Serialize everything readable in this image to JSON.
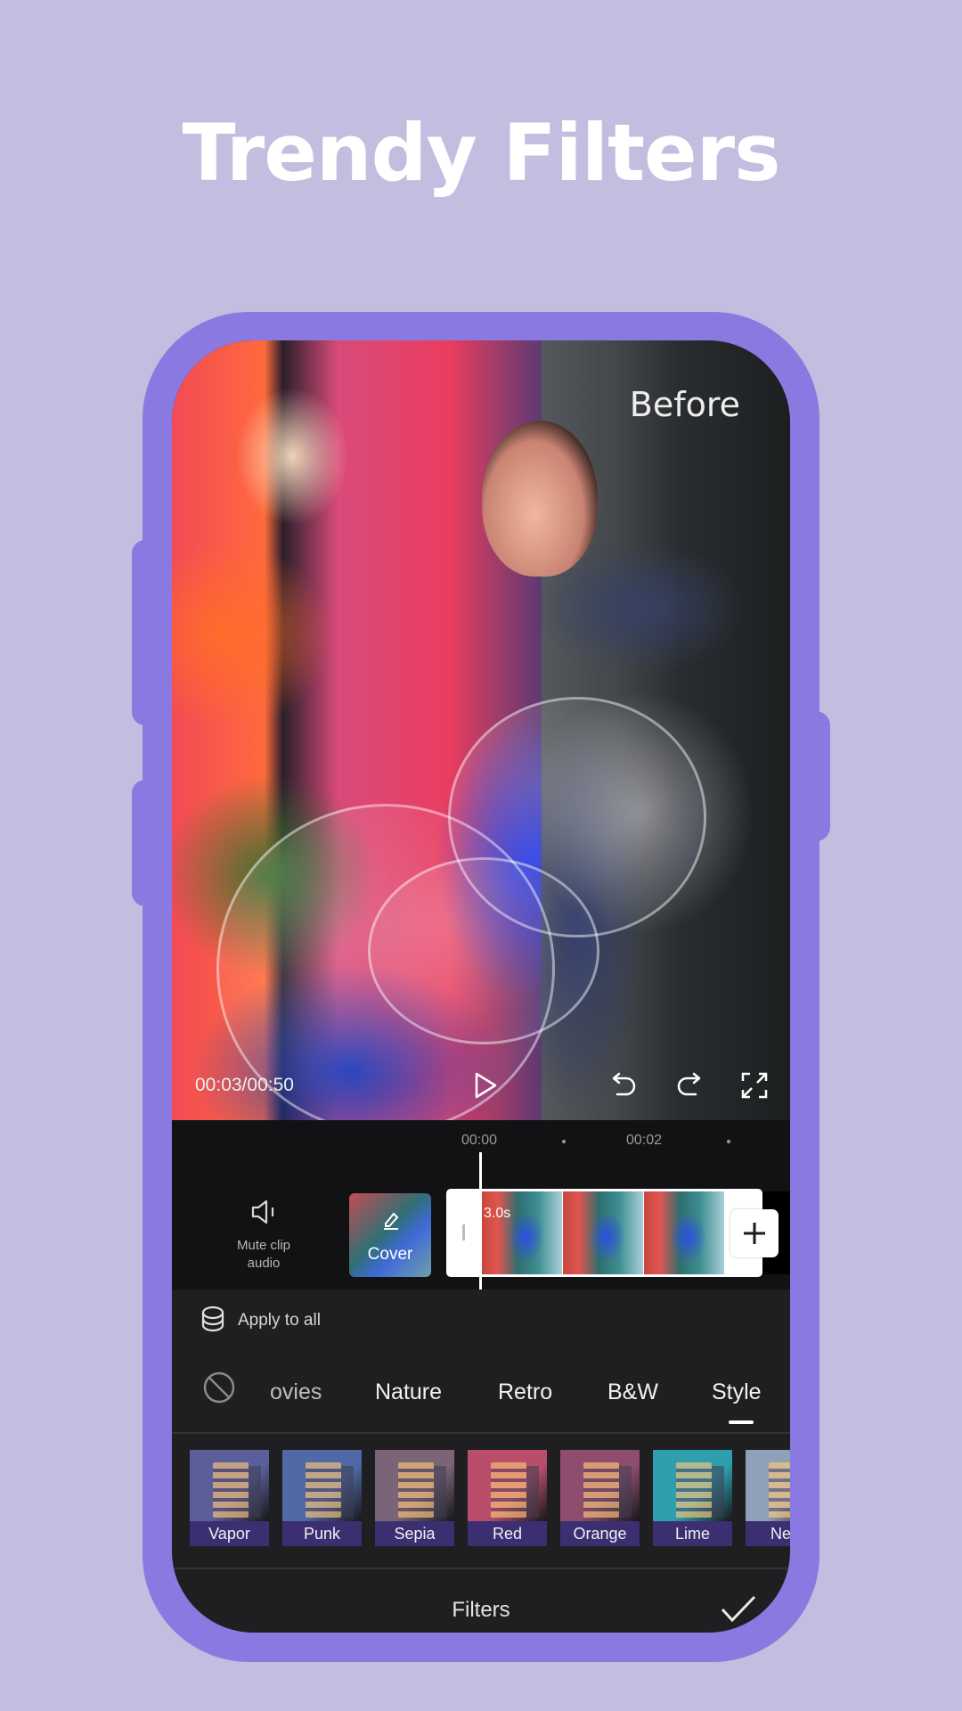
{
  "headline": "Trendy Filters",
  "preview": {
    "compare_label": "Before",
    "time_readout": "00:03/00:50",
    "icons": [
      "play-icon",
      "undo-icon",
      "redo-icon",
      "fullscreen-icon"
    ]
  },
  "timeline": {
    "ruler": [
      "00:00",
      "00:02"
    ],
    "mute_label_line1": "Mute clip",
    "mute_label_line2": "audio",
    "cover_label": "Cover",
    "clip_duration": "3.0s"
  },
  "filters_panel": {
    "apply_all_label": "Apply to all",
    "categories": [
      {
        "label": "ovies",
        "partial": true
      },
      {
        "label": "Nature"
      },
      {
        "label": "Retro"
      },
      {
        "label": "B&W"
      },
      {
        "label": "Style",
        "selected": true
      }
    ],
    "filters": [
      {
        "label": "Vapor",
        "tint": "#5a5f9a"
      },
      {
        "label": "Punk",
        "tint": "#4f6aa6"
      },
      {
        "label": "Sepia",
        "tint": "#7a6478"
      },
      {
        "label": "Red",
        "tint": "#b84e6a"
      },
      {
        "label": "Orange",
        "tint": "#8e4d6e"
      },
      {
        "label": "Lime",
        "tint": "#2f9fae"
      },
      {
        "label": "Neo",
        "tint": "#8fa0b8"
      }
    ],
    "title": "Filters"
  },
  "colors": {
    "background": "#c3bde0",
    "phone_frame": "#8a79e0",
    "panel": "#1f1e21",
    "filter_label_bg": "#3b2f72"
  }
}
